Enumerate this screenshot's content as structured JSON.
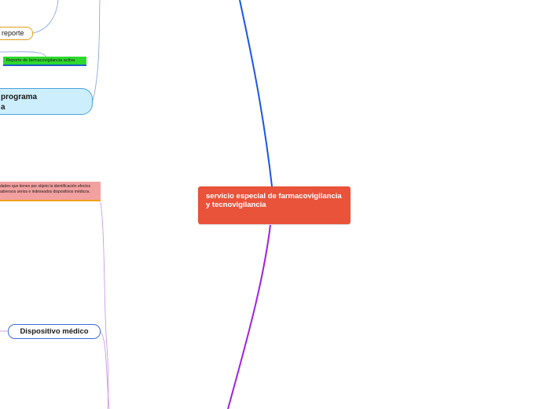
{
  "central": {
    "label": "servicio especial de farmacovigilancia y tecnovigilancia",
    "color": "#e8533a"
  },
  "branches": {
    "reporte": {
      "label": "reporte",
      "border_color": "#e0a01a"
    },
    "reporte_activo": {
      "label": "Reporte de farmacovigilancia activa",
      "fill_color": "#2ed82e"
    },
    "programa": {
      "label": "programa\na",
      "fill_color": "#cdeefc"
    },
    "definicion": {
      "label": "dades que tienen por objeto la identificación efectos adversos serios e indeseados dispositivos médicos.",
      "fill_color": "#f3a0a0"
    },
    "dispositivo": {
      "label": "Dispositivo médico",
      "border_color": "#3a6fd8"
    }
  },
  "connector_colors": {
    "upper": "#1a56e6",
    "lower": "#a020e0",
    "thin_blue": "#7f9fe0",
    "thin_purple": "#c48ee8"
  }
}
